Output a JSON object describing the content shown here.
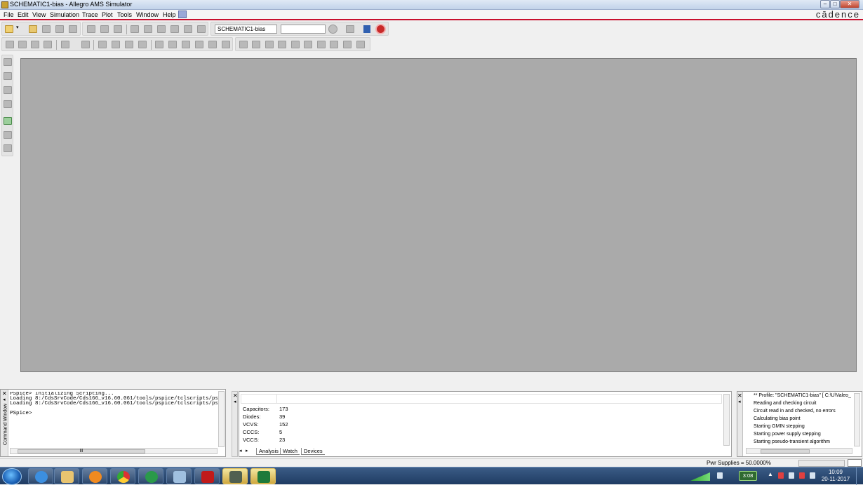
{
  "window": {
    "title": "SCHEMATIC1-bias - Allegro AMS Simulator",
    "brand": "cādence"
  },
  "menu": [
    "File",
    "Edit",
    "View",
    "Simulation",
    "Trace",
    "Plot",
    "Tools",
    "Window",
    "Help"
  ],
  "toolbar": {
    "profile_value": "SCHEMATIC1-bias",
    "second_value": ""
  },
  "command_window": {
    "label": "Command Window",
    "lines": "PSpice> Initializing Scripting...\nLoading 8:/CdsSrvCode/Cds166_v16.60.061/tools/pspice/tclscripts/ps\nLoading 8:/CdsSrvCode/Cds166_v16.60.061/tools/pspice/tclscripts/ps\n\nPSpice>",
    "scroll_mark": "III"
  },
  "devices": [
    {
      "name": "Capacitors:",
      "count": "173"
    },
    {
      "name": "Diodes:",
      "count": "39"
    },
    {
      "name": "VCVS:",
      "count": "152"
    },
    {
      "name": "CCCS:",
      "count": "5"
    },
    {
      "name": "VCCS:",
      "count": "23"
    }
  ],
  "tabs": [
    "Analysis",
    "Watch",
    "Devices"
  ],
  "active_tab": "Devices",
  "output": [
    "** Profile: \"SCHEMATIC1-bias\"  [ C:\\U\\Valeo_",
    "Reading and checking circuit",
    "Circuit read in and checked, no errors",
    "Calculating bias point",
    "Starting GMIN stepping",
    "Starting power supply stepping",
    "Starting pseudo-transient algorithm"
  ],
  "status": {
    "pwr_supplies": "Pwr Supplies =  50.0000%"
  },
  "taskbar": {
    "time": "10:09",
    "date": "20-11-2017",
    "battery": "3:08"
  },
  "colors": {
    "accent_red": "#c8102e",
    "workspace": "#aaaaaa"
  }
}
